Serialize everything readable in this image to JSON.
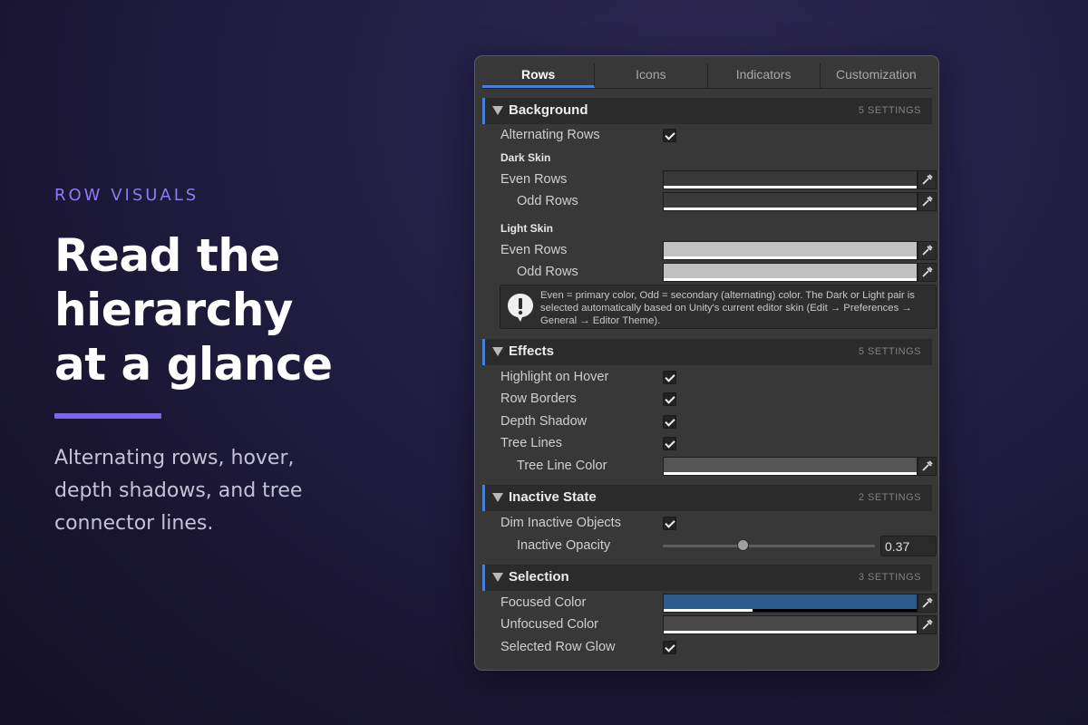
{
  "promo": {
    "eyebrow": "ROW VISUALS",
    "headline_1": "Read the",
    "headline_2": "hierarchy",
    "headline_3": "at a glance",
    "sub_1": "Alternating rows, hover,",
    "sub_2": "depth shadows, and tree",
    "sub_3": "connector lines."
  },
  "tabs": [
    "Rows",
    "Icons",
    "Indicators",
    "Customization"
  ],
  "active_tab": "Rows",
  "background": {
    "title": "Background",
    "count": "5 SETTINGS",
    "alternating_rows": "Alternating Rows",
    "dark_skin": "Dark Skin",
    "dark_even": "Even Rows",
    "dark_odd": "Odd Rows",
    "light_skin": "Light Skin",
    "light_even": "Even Rows",
    "light_odd": "Odd Rows",
    "help": "Even = primary color, Odd = secondary (alternating) color. The Dark or Light pair is selected automatically based on Unity's current editor skin (Edit → Preferences → General → Editor Theme)."
  },
  "effects": {
    "title": "Effects",
    "count": "5 SETTINGS",
    "highlight_on_hover": "Highlight on Hover",
    "row_borders": "Row Borders",
    "depth_shadow": "Depth Shadow",
    "tree_lines": "Tree Lines",
    "tree_line_color": "Tree Line Color"
  },
  "inactive": {
    "title": "Inactive State",
    "count": "2 SETTINGS",
    "dim_inactive": "Dim Inactive Objects",
    "inactive_opacity": "Inactive Opacity",
    "opacity_value": "0.37"
  },
  "selection": {
    "title": "Selection",
    "count": "3 SETTINGS",
    "focused_color": "Focused Color",
    "unfocused_color": "Unfocused Color",
    "selected_glow": "Selected Row Glow"
  },
  "colors": {
    "accent": "#4a7fd6",
    "dark_even": "#383838",
    "dark_odd": "#3a3a3a",
    "light_even": "#c2c2c2",
    "light_odd": "#c0c0c0",
    "tree_line": "#555555",
    "focused": "#2c5d8a",
    "unfocused": "#484848"
  }
}
